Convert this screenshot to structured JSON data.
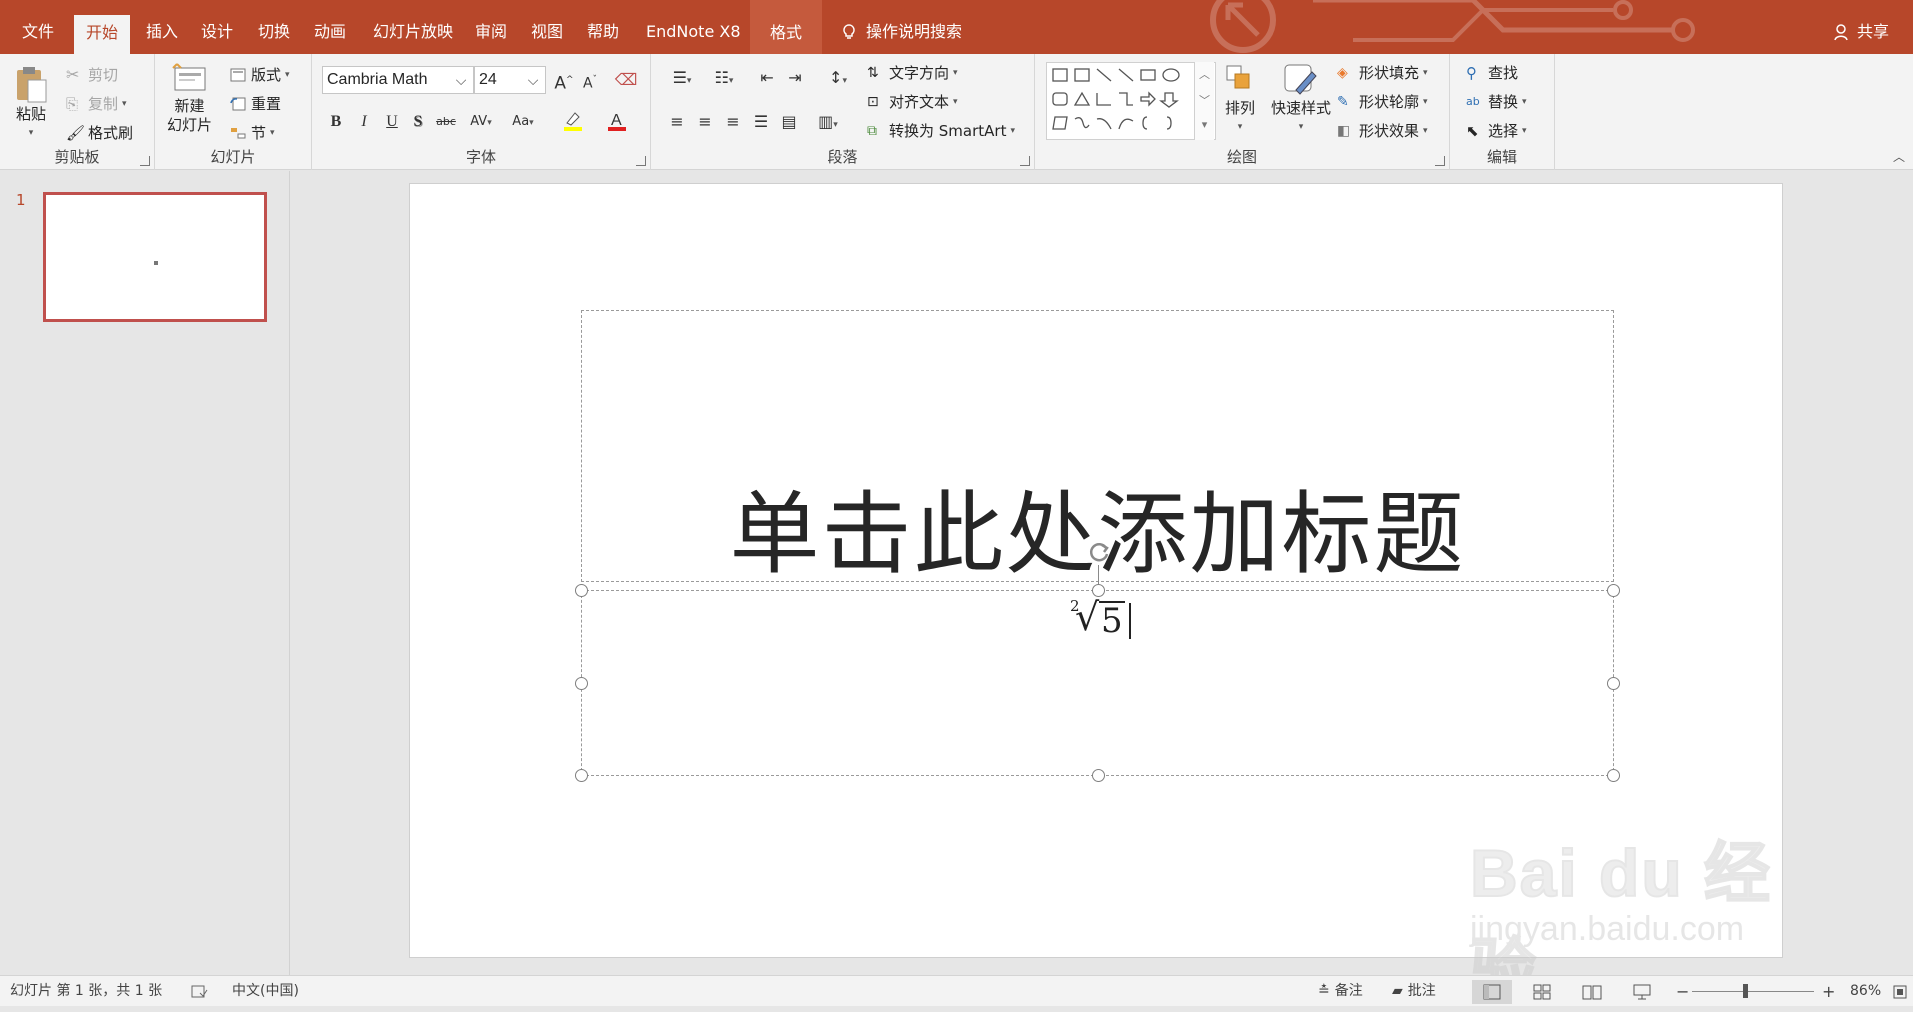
{
  "tabs": {
    "file": "文件",
    "home": "开始",
    "insert": "插入",
    "design": "设计",
    "transitions": "切换",
    "animations": "动画",
    "slideshow": "幻灯片放映",
    "review": "审阅",
    "view": "视图",
    "help": "帮助",
    "endnote": "EndNote X8",
    "format": "格式"
  },
  "tell_me": "操作说明搜索",
  "share": "共享",
  "ribbon": {
    "clipboard": {
      "paste": "粘贴",
      "cut": "剪切",
      "copy": "复制",
      "format_painter": "格式刷",
      "label": "剪贴板"
    },
    "slides": {
      "new_slide_1": "新建",
      "new_slide_2": "幻灯片",
      "layout": "版式",
      "reset": "重置",
      "section": "节",
      "label": "幻灯片"
    },
    "font": {
      "name": "Cambria Math",
      "size": "24",
      "label": "字体",
      "bold": "B",
      "italic": "I",
      "underline": "U",
      "shadow": "S",
      "strike": "abc",
      "spacing": "AV",
      "case": "Aa",
      "grow": "A",
      "shrink": "A"
    },
    "paragraph": {
      "text_direction": "文字方向",
      "align_text": "对齐文本",
      "smartart": "转换为 SmartArt",
      "label": "段落"
    },
    "drawing": {
      "arrange": "排列",
      "quick_styles": "快速样式",
      "shape_fill": "形状填充",
      "shape_outline": "形状轮廓",
      "shape_effects": "形状效果",
      "label": "绘图"
    },
    "editing": {
      "find": "查找",
      "replace": "替换",
      "select": "选择",
      "label": "编辑"
    }
  },
  "thumbnails": [
    {
      "number": "1"
    }
  ],
  "slide": {
    "title": "单击此处添加标题",
    "equation": {
      "index": "2",
      "radical": "√",
      "radicand": "5"
    }
  },
  "watermark": {
    "logo": "Bai du 经验",
    "url": "jingyan.baidu.com"
  },
  "status": {
    "slide_info": "幻灯片 第 1 张，共 1 张",
    "language": "中文(中国)",
    "notes": "备注",
    "comments": "批注",
    "zoom": "86%",
    "zoom_minus": "−",
    "zoom_plus": "+"
  },
  "colors": {
    "accent": "#b7472a",
    "thumb_border": "#c0504d"
  }
}
